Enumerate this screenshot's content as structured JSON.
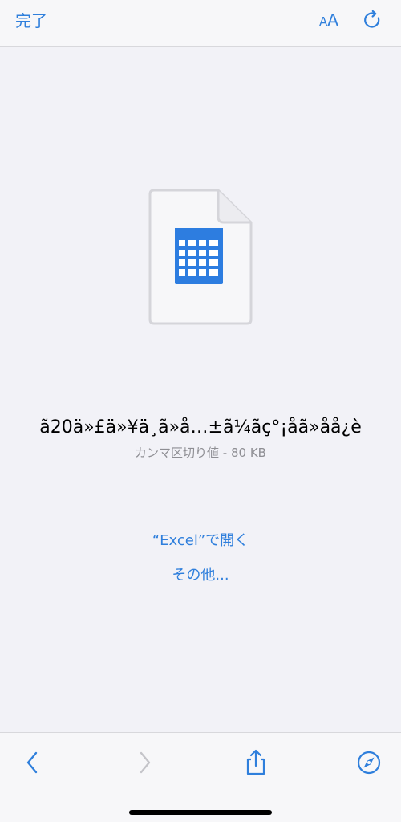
{
  "header": {
    "done_label": "完了",
    "text_size_small": "A",
    "text_size_large": "A",
    "text_size_icon": "text-size-icon",
    "reload_icon": "reload-icon"
  },
  "document": {
    "icon": "spreadsheet-file-icon",
    "file_name": "ã20ä»£ä»¥ä¸ã»å…±ã¼ãç°¡åã»åå¿è",
    "file_info": "カンマ区切り値 - 80 KB"
  },
  "actions": {
    "open_in_excel": "“Excel”で開く",
    "more": "その他..."
  },
  "toolbar": {
    "back_icon": "chevron-left-icon",
    "forward_icon": "chevron-right-icon",
    "share_icon": "share-icon",
    "safari_icon": "compass-icon"
  },
  "colors": {
    "accent": "#2f7fdc",
    "background": "#f2f2f7",
    "secondary_text": "#8e8e93",
    "grid_blue": "#2d7de0"
  }
}
